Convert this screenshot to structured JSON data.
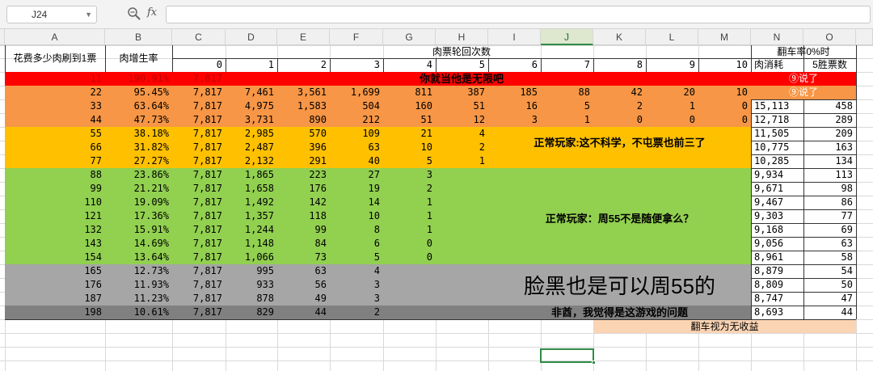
{
  "formula_bar": {
    "name_box": "J24",
    "fx_label": "fx",
    "formula": ""
  },
  "column_letters": [
    "A",
    "B",
    "C",
    "D",
    "E",
    "F",
    "G",
    "H",
    "I",
    "J",
    "K",
    "L",
    "M",
    "N",
    "O"
  ],
  "selected_column": "J",
  "header": {
    "col_a": "花费多少肉刷到1票",
    "col_b": "肉增生率",
    "rounds_title": "肉票轮回次数",
    "rounds": [
      "0",
      "1",
      "2",
      "3",
      "4",
      "5",
      "6",
      "7",
      "8",
      "9",
      "10"
    ],
    "flip_title": "翻车率0%时",
    "meat_cost": "肉消耗",
    "wins_5": "5胜票数"
  },
  "rows": [
    {
      "a": "11",
      "b": "190.91%",
      "c": "7,817",
      "d": "",
      "e": "",
      "f": "",
      "g": "",
      "h": "",
      "i": "",
      "j": "",
      "k": "",
      "l": "",
      "m": "",
      "n": "",
      "o": ""
    },
    {
      "a": "22",
      "b": "95.45%",
      "c": "7,817",
      "d": "7,461",
      "e": "3,561",
      "f": "1,699",
      "g": "811",
      "h": "387",
      "i": "185",
      "j": "88",
      "k": "42",
      "l": "20",
      "m": "10",
      "n": "",
      "o": ""
    },
    {
      "a": "33",
      "b": "63.64%",
      "c": "7,817",
      "d": "4,975",
      "e": "1,583",
      "f": "504",
      "g": "160",
      "h": "51",
      "i": "16",
      "j": "5",
      "k": "2",
      "l": "1",
      "m": "0",
      "n": "15,113",
      "o": "458"
    },
    {
      "a": "44",
      "b": "47.73%",
      "c": "7,817",
      "d": "3,731",
      "e": "890",
      "f": "212",
      "g": "51",
      "h": "12",
      "i": "3",
      "j": "1",
      "k": "0",
      "l": "0",
      "m": "0",
      "n": "12,718",
      "o": "289"
    },
    {
      "a": "55",
      "b": "38.18%",
      "c": "7,817",
      "d": "2,985",
      "e": "570",
      "f": "109",
      "g": "21",
      "h": "4",
      "i": "",
      "j": "",
      "k": "",
      "l": "",
      "m": "",
      "n": "11,505",
      "o": "209"
    },
    {
      "a": "66",
      "b": "31.82%",
      "c": "7,817",
      "d": "2,487",
      "e": "396",
      "f": "63",
      "g": "10",
      "h": "2",
      "i": "",
      "j": "",
      "k": "",
      "l": "",
      "m": "",
      "n": "10,775",
      "o": "163"
    },
    {
      "a": "77",
      "b": "27.27%",
      "c": "7,817",
      "d": "2,132",
      "e": "291",
      "f": "40",
      "g": "5",
      "h": "1",
      "i": "",
      "j": "",
      "k": "",
      "l": "",
      "m": "",
      "n": "10,285",
      "o": "134"
    },
    {
      "a": "88",
      "b": "23.86%",
      "c": "7,817",
      "d": "1,865",
      "e": "223",
      "f": "27",
      "g": "3",
      "h": "",
      "i": "",
      "j": "",
      "k": "",
      "l": "",
      "m": "",
      "n": "9,934",
      "o": "113"
    },
    {
      "a": "99",
      "b": "21.21%",
      "c": "7,817",
      "d": "1,658",
      "e": "176",
      "f": "19",
      "g": "2",
      "h": "",
      "i": "",
      "j": "",
      "k": "",
      "l": "",
      "m": "",
      "n": "9,671",
      "o": "98"
    },
    {
      "a": "110",
      "b": "19.09%",
      "c": "7,817",
      "d": "1,492",
      "e": "142",
      "f": "14",
      "g": "1",
      "h": "",
      "i": "",
      "j": "",
      "k": "",
      "l": "",
      "m": "",
      "n": "9,467",
      "o": "86"
    },
    {
      "a": "121",
      "b": "17.36%",
      "c": "7,817",
      "d": "1,357",
      "e": "118",
      "f": "10",
      "g": "1",
      "h": "",
      "i": "",
      "j": "",
      "k": "",
      "l": "",
      "m": "",
      "n": "9,303",
      "o": "77"
    },
    {
      "a": "132",
      "b": "15.91%",
      "c": "7,817",
      "d": "1,244",
      "e": "99",
      "f": "8",
      "g": "1",
      "h": "",
      "i": "",
      "j": "",
      "k": "",
      "l": "",
      "m": "",
      "n": "9,168",
      "o": "69"
    },
    {
      "a": "143",
      "b": "14.69%",
      "c": "7,817",
      "d": "1,148",
      "e": "84",
      "f": "6",
      "g": "0",
      "h": "",
      "i": "",
      "j": "",
      "k": "",
      "l": "",
      "m": "",
      "n": "9,056",
      "o": "63"
    },
    {
      "a": "154",
      "b": "13.64%",
      "c": "7,817",
      "d": "1,066",
      "e": "73",
      "f": "5",
      "g": "0",
      "h": "",
      "i": "",
      "j": "",
      "k": "",
      "l": "",
      "m": "",
      "n": "8,961",
      "o": "58"
    },
    {
      "a": "165",
      "b": "12.73%",
      "c": "7,817",
      "d": "995",
      "e": "63",
      "f": "4",
      "g": "",
      "h": "",
      "i": "",
      "j": "",
      "k": "",
      "l": "",
      "m": "",
      "n": "8,879",
      "o": "54"
    },
    {
      "a": "176",
      "b": "11.93%",
      "c": "7,817",
      "d": "933",
      "e": "56",
      "f": "3",
      "g": "",
      "h": "",
      "i": "",
      "j": "",
      "k": "",
      "l": "",
      "m": "",
      "n": "8,809",
      "o": "50"
    },
    {
      "a": "187",
      "b": "11.23%",
      "c": "7,817",
      "d": "878",
      "e": "49",
      "f": "3",
      "g": "",
      "h": "",
      "i": "",
      "j": "",
      "k": "",
      "l": "",
      "m": "",
      "n": "8,747",
      "o": "47"
    },
    {
      "a": "198",
      "b": "10.61%",
      "c": "7,817",
      "d": "829",
      "e": "44",
      "f": "2",
      "g": "",
      "h": "",
      "i": "",
      "j": "",
      "k": "",
      "l": "",
      "m": "",
      "n": "8,693",
      "o": "44"
    }
  ],
  "annotations": {
    "row11_banner": "你就当他是无限吧",
    "row11_note": "⑨说了",
    "row22_note": "⑨说了",
    "orange_note": "正常玩家:这不科学，不屯票也前三了",
    "green_note": "正常玩家：周55不是随便拿么？",
    "gray_big": "脸黑也是可以周55的",
    "gray_small": "非酋，我觉得是这游戏的问题",
    "flip_note": "翻车视为无收益"
  },
  "colors": {
    "red": "#ff0000",
    "orange": "#f79646",
    "amber": "#ffc000",
    "green": "#92d050",
    "gray": "#a6a6a6",
    "dark_gray": "#808080",
    "peach": "#fbd4b4",
    "grid_line": "#d9d9d9",
    "select_green": "#2f8c46"
  },
  "icons": {
    "zoom": "zoom-formula-icon",
    "dropdown": "chevron-down-icon"
  }
}
